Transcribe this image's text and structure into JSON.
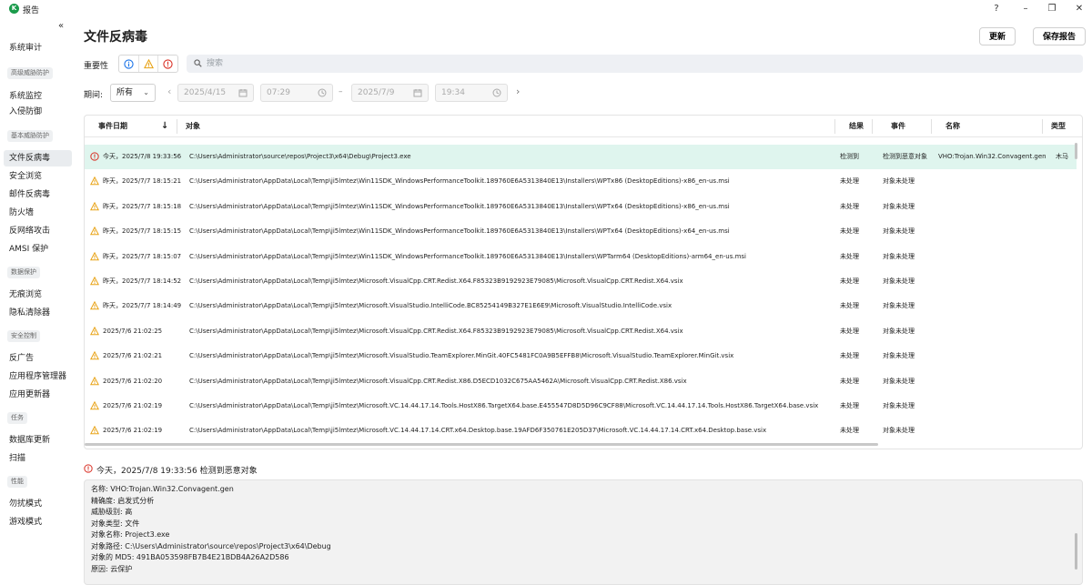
{
  "window": {
    "title": "报告",
    "controls": [
      "?",
      "–",
      "❐",
      "✕"
    ]
  },
  "sidebar": {
    "collapse_label": "«",
    "items": [
      {
        "kind": "item",
        "label": "系统审计"
      },
      {
        "kind": "section",
        "label": "高级威胁防护"
      },
      {
        "kind": "item",
        "label": "系统监控"
      },
      {
        "kind": "item",
        "label": "入侵防御"
      },
      {
        "kind": "section",
        "label": "基本威胁防护"
      },
      {
        "kind": "item",
        "label": "文件反病毒",
        "active": true
      },
      {
        "kind": "item",
        "label": "安全浏览"
      },
      {
        "kind": "item",
        "label": "邮件反病毒"
      },
      {
        "kind": "item",
        "label": "防火墙"
      },
      {
        "kind": "item",
        "label": "反网络攻击"
      },
      {
        "kind": "item",
        "label": "AMSI 保护"
      },
      {
        "kind": "section",
        "label": "数据保护"
      },
      {
        "kind": "item",
        "label": "无痕浏览"
      },
      {
        "kind": "item",
        "label": "隐私清除器"
      },
      {
        "kind": "section",
        "label": "安全控制"
      },
      {
        "kind": "item",
        "label": "反广告"
      },
      {
        "kind": "item",
        "label": "应用程序管理器"
      },
      {
        "kind": "item",
        "label": "应用更新器"
      },
      {
        "kind": "section",
        "label": "任务"
      },
      {
        "kind": "item",
        "label": "数据库更新"
      },
      {
        "kind": "item",
        "label": "扫描"
      },
      {
        "kind": "section",
        "label": "性能"
      },
      {
        "kind": "item",
        "label": "勿扰模式"
      },
      {
        "kind": "item",
        "label": "游戏模式"
      }
    ]
  },
  "header": {
    "title": "文件反病毒",
    "update_button": "更新",
    "save_report_button": "保存报告"
  },
  "filters": {
    "importance_label": "重要性",
    "search_placeholder": "搜索",
    "period_label": "期间:",
    "period_value": "所有",
    "start_date": "2025/4/15",
    "start_time": "07:29",
    "dash": "–",
    "end_date": "2025/7/9",
    "end_time": "19:34",
    "prev_arrow": "‹",
    "next_arrow": "›"
  },
  "table": {
    "columns": {
      "date": "事件日期",
      "object": "对象",
      "result": "结果",
      "event": "事件",
      "name": "名称",
      "type": "类型"
    },
    "rows": [
      {
        "severity": "critical",
        "date": "今天，2025/7/8 19:33:56",
        "object": "C:\\Users\\Administrator\\source\\repos\\Project3\\x64\\Debug\\Project3.exe",
        "result": "检测到",
        "event": "检测到恶意对象",
        "name": "VHO:Trojan.Win32.Convagent.gen",
        "type": "木马"
      },
      {
        "severity": "warning",
        "date": "昨天，2025/7/7 18:15:21",
        "object": "C:\\Users\\Administrator\\AppData\\Local\\Temp\\ji5lmtez\\Win11SDK_WindowsPerformanceToolkit.189760E6A5313840E13\\Installers\\WPTx86 (DesktopEditions)-x86_en-us.msi",
        "result": "未处理",
        "event": "对象未处理",
        "name": "",
        "type": ""
      },
      {
        "severity": "warning",
        "date": "昨天，2025/7/7 18:15:18",
        "object": "C:\\Users\\Administrator\\AppData\\Local\\Temp\\ji5lmtez\\Win11SDK_WindowsPerformanceToolkit.189760E6A5313840E13\\Installers\\WPTx64 (DesktopEditions)-x86_en-us.msi",
        "result": "未处理",
        "event": "对象未处理",
        "name": "",
        "type": ""
      },
      {
        "severity": "warning",
        "date": "昨天，2025/7/7 18:15:15",
        "object": "C:\\Users\\Administrator\\AppData\\Local\\Temp\\ji5lmtez\\Win11SDK_WindowsPerformanceToolkit.189760E6A5313840E13\\Installers\\WPTx64 (DesktopEditions)-x64_en-us.msi",
        "result": "未处理",
        "event": "对象未处理",
        "name": "",
        "type": ""
      },
      {
        "severity": "warning",
        "date": "昨天，2025/7/7 18:15:07",
        "object": "C:\\Users\\Administrator\\AppData\\Local\\Temp\\ji5lmtez\\Win11SDK_WindowsPerformanceToolkit.189760E6A5313840E13\\Installers\\WPTarm64 (DesktopEditions)-arm64_en-us.msi",
        "result": "未处理",
        "event": "对象未处理",
        "name": "",
        "type": ""
      },
      {
        "severity": "warning",
        "date": "昨天，2025/7/7 18:14:52",
        "object": "C:\\Users\\Administrator\\AppData\\Local\\Temp\\ji5lmtez\\Microsoft.VisualCpp.CRT.Redist.X64.F85323B9192923E79085\\Microsoft.VisualCpp.CRT.Redist.X64.vsix",
        "result": "未处理",
        "event": "对象未处理",
        "name": "",
        "type": ""
      },
      {
        "severity": "warning",
        "date": "昨天，2025/7/7 18:14:49",
        "object": "C:\\Users\\Administrator\\AppData\\Local\\Temp\\ji5lmtez\\Microsoft.VisualStudio.IntelliCode.BC85254149B327E1E6E9\\Microsoft.VisualStudio.IntelliCode.vsix",
        "result": "未处理",
        "event": "对象未处理",
        "name": "",
        "type": ""
      },
      {
        "severity": "warning",
        "date": "2025/7/6 21:02:25",
        "object": "C:\\Users\\Administrator\\AppData\\Local\\Temp\\ji5lmtez\\Microsoft.VisualCpp.CRT.Redist.X64.F85323B9192923E79085\\Microsoft.VisualCpp.CRT.Redist.X64.vsix",
        "result": "未处理",
        "event": "对象未处理",
        "name": "",
        "type": ""
      },
      {
        "severity": "warning",
        "date": "2025/7/6 21:02:21",
        "object": "C:\\Users\\Administrator\\AppData\\Local\\Temp\\ji5lmtez\\Microsoft.VisualStudio.TeamExplorer.MinGit.40FC5481FC0A9B5EFFB8\\Microsoft.VisualStudio.TeamExplorer.MinGit.vsix",
        "result": "未处理",
        "event": "对象未处理",
        "name": "",
        "type": ""
      },
      {
        "severity": "warning",
        "date": "2025/7/6 21:02:20",
        "object": "C:\\Users\\Administrator\\AppData\\Local\\Temp\\ji5lmtez\\Microsoft.VisualCpp.CRT.Redist.X86.D5ECD1032C675AA5462A\\Microsoft.VisualCpp.CRT.Redist.X86.vsix",
        "result": "未处理",
        "event": "对象未处理",
        "name": "",
        "type": ""
      },
      {
        "severity": "warning",
        "date": "2025/7/6 21:02:19",
        "object": "C:\\Users\\Administrator\\AppData\\Local\\Temp\\ji5lmtez\\Microsoft.VC.14.44.17.14.Tools.HostX86.TargetX64.base.E455547D8D5D96C9CF88\\Microsoft.VC.14.44.17.14.Tools.HostX86.TargetX64.base.vsix",
        "result": "未处理",
        "event": "对象未处理",
        "name": "",
        "type": ""
      },
      {
        "severity": "warning",
        "date": "2025/7/6 21:02:19",
        "object": "C:\\Users\\Administrator\\AppData\\Local\\Temp\\ji5lmtez\\Microsoft.VC.14.44.17.14.CRT.x64.Desktop.base.19AFD6F350761E205D37\\Microsoft.VC.14.44.17.14.CRT.x64.Desktop.base.vsix",
        "result": "未处理",
        "event": "对象未处理",
        "name": "",
        "type": ""
      }
    ]
  },
  "detail": {
    "title": "今天，2025/7/8 19:33:56 检测到恶意对象",
    "lines": [
      "名称: VHO:Trojan.Win32.Convagent.gen",
      "精确度: 启发式分析",
      "威胁级别: 高",
      "对象类型: 文件",
      "对象名称: Project3.exe",
      "对象路径: C:\\Users\\Administrator\\source\\repos\\Project3\\x64\\Debug",
      "对象的 MD5: 491BA053598FB7B4E21BDB4A26A2D586",
      "原因: 云保护"
    ]
  },
  "colors": {
    "selected_row": "#dff5ee",
    "critical": "#d93025",
    "warning": "#e8a317",
    "info": "#1a73e8",
    "brand": "#1a9b4b"
  }
}
